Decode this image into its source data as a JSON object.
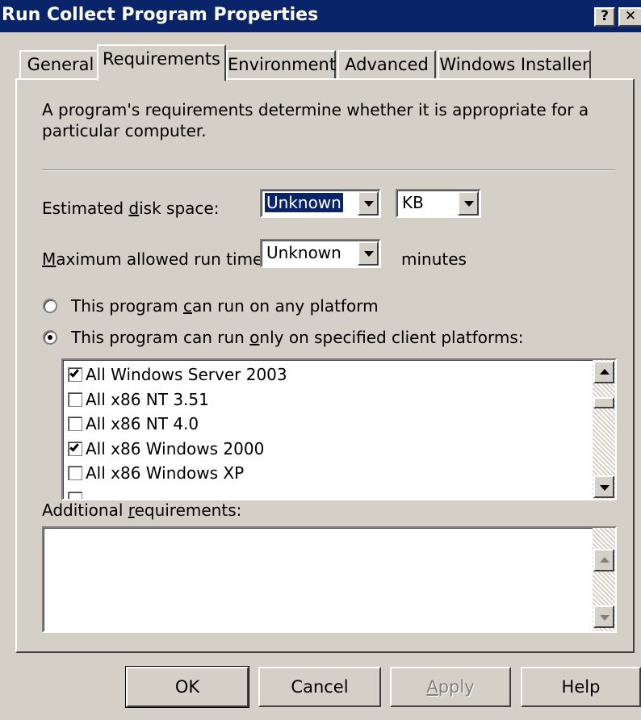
{
  "window": {
    "title": "Run Collect Program Properties",
    "help_glyph": "?",
    "close_glyph": "✕"
  },
  "tabs": [
    {
      "label": "General"
    },
    {
      "label": "Requirements",
      "active": true
    },
    {
      "label": "Environment"
    },
    {
      "label": "Advanced"
    },
    {
      "label": "Windows Installer"
    }
  ],
  "description": "A program's requirements determine whether it is appropriate for a particular computer.",
  "disk_space": {
    "label_pre": "Estimated ",
    "label_mnemonic": "d",
    "label_post": "isk space:",
    "value": "Unknown",
    "unit": "KB"
  },
  "run_time": {
    "label_mnemonic": "M",
    "label_post": "aximum allowed run time:",
    "value": "Unknown",
    "unit_label": "minutes"
  },
  "platform_options": {
    "any": {
      "pre": "This program ",
      "mnemonic": "c",
      "post": "an run on any platform",
      "selected": false
    },
    "specified": {
      "pre": "This program can run ",
      "mnemonic": "o",
      "post": "nly on specified client platforms:",
      "selected": true
    }
  },
  "platforms": [
    {
      "label": "All Windows Server 2003",
      "checked": true
    },
    {
      "label": "All x86 NT 3.51",
      "checked": false
    },
    {
      "label": "All x86 NT 4.0",
      "checked": false
    },
    {
      "label": "All x86 Windows 2000",
      "checked": true
    },
    {
      "label": "All x86 Windows XP",
      "checked": false
    }
  ],
  "additional": {
    "pre": "Additional ",
    "mnemonic": "r",
    "post": "equirements:",
    "value": ""
  },
  "buttons": {
    "ok": "OK",
    "cancel": "Cancel",
    "apply_mnemonic": "A",
    "apply_post": "pply",
    "help": "Help"
  },
  "colors": {
    "titlebar": "#0a246a",
    "face": "#d4d0c8",
    "selection": "#0a246a"
  }
}
